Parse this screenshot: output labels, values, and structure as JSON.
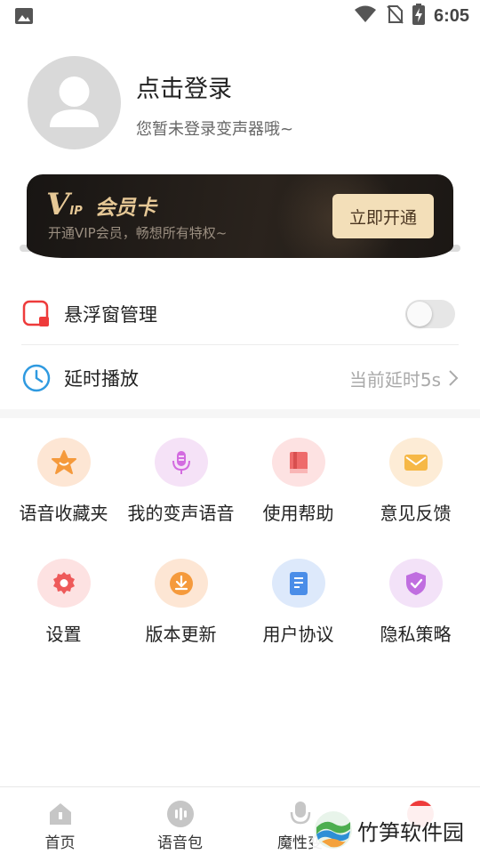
{
  "status_bar": {
    "time": "6:05"
  },
  "profile": {
    "title": "点击登录",
    "subtitle": "您暂未登录变声器哦~"
  },
  "vip": {
    "logo_v": "V",
    "logo_ip": "IP",
    "logo_name": "会员卡",
    "subtitle": "开通VIP会员，畅想所有特权~",
    "button": "立即开通"
  },
  "settings": {
    "float_label": "悬浮窗管理",
    "float_toggle_on": false,
    "delay_label": "延时播放",
    "delay_value": "当前延时5s"
  },
  "grid": [
    {
      "label": "语音收藏夹",
      "icon": "star-icon",
      "color": "#fde6d4",
      "icon_color": "#f59a3c"
    },
    {
      "label": "我的变声语音",
      "icon": "microphone-icon",
      "color": "#f5e2f7",
      "icon_color": "#d36be0"
    },
    {
      "label": "使用帮助",
      "icon": "book-icon",
      "color": "#fde2e2",
      "icon_color": "#ee6b6b"
    },
    {
      "label": "意见反馈",
      "icon": "envelope-icon",
      "color": "#fdecd6",
      "icon_color": "#f6b847"
    },
    {
      "label": "设置",
      "icon": "gear-icon",
      "color": "#fde2e2",
      "icon_color": "#ee5a5a"
    },
    {
      "label": "版本更新",
      "icon": "download-icon",
      "color": "#fde6d4",
      "icon_color": "#f59a3c"
    },
    {
      "label": "用户协议",
      "icon": "document-icon",
      "color": "#dde9fb",
      "icon_color": "#4a8de8"
    },
    {
      "label": "隐私策略",
      "icon": "shield-icon",
      "color": "#f3e2f8",
      "icon_color": "#c06ee0"
    }
  ],
  "bottom_nav": [
    {
      "label": "首页",
      "icon": "home-icon"
    },
    {
      "label": "语音包",
      "icon": "audio-pack-icon"
    },
    {
      "label": "魔性变",
      "icon": "voice-change-icon"
    },
    {
      "label": "",
      "icon": "profile-icon"
    }
  ],
  "watermark": {
    "text": "竹笋软件园"
  }
}
